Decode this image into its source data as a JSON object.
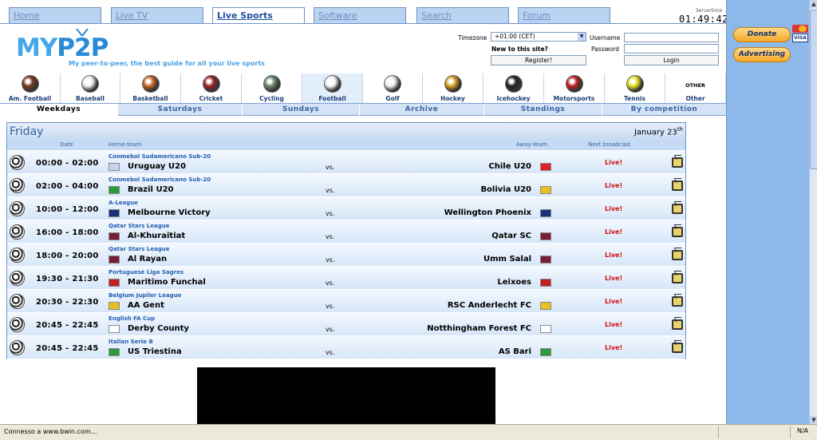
{
  "top_tabs": [
    {
      "label": "Home"
    },
    {
      "label": "Live TV"
    },
    {
      "label": "Live Sports"
    },
    {
      "label": "Software"
    },
    {
      "label": "Search"
    },
    {
      "label": "Forum"
    }
  ],
  "servertime": {
    "label": "Servertime",
    "value": "01:49:42"
  },
  "logo": {
    "text_a": "MY",
    "text_b": "P2P",
    "tagline": "My peer-to-peer, the best guide for all your live sports"
  },
  "login": {
    "timezone_label": "Timezone",
    "timezone_value": "+01:00 (CET)",
    "new_label": "New to this site?",
    "register_label": "Register!",
    "username_label": "Username",
    "password_label": "Password",
    "login_label": "Login"
  },
  "sidebar": {
    "donate_label": "Donate",
    "advertising_label": "Advertising",
    "visa_label": "VISA"
  },
  "sports": [
    {
      "label": "Am. Football",
      "icon": "american-football-icon",
      "color": "#7a3a1a"
    },
    {
      "label": "Baseball",
      "icon": "baseball-icon",
      "color": "#f0f0f0"
    },
    {
      "label": "Basketball",
      "icon": "basketball-icon",
      "color": "#c8652a"
    },
    {
      "label": "Cricket",
      "icon": "cricket-ball-icon",
      "color": "#9a2222"
    },
    {
      "label": "Cycling",
      "icon": "cycling-icon",
      "color": "#6a8a6a"
    },
    {
      "label": "Football",
      "icon": "football-icon",
      "color": "#f5f5f5"
    },
    {
      "label": "Golf",
      "icon": "golf-ball-icon",
      "color": "#eeeeee"
    },
    {
      "label": "Hockey",
      "icon": "hockey-icon",
      "color": "#d8a020"
    },
    {
      "label": "Icehockey",
      "icon": "puck-icon",
      "color": "#222222"
    },
    {
      "label": "Motorsports",
      "icon": "race-car-icon",
      "color": "#c02020"
    },
    {
      "label": "Tennis",
      "icon": "tennis-ball-icon",
      "color": "#e8e020"
    },
    {
      "label": "Other",
      "icon": "other-icon",
      "color": "#ffffff",
      "badge": "OTHER"
    }
  ],
  "day_tabs": [
    {
      "label": "Weekdays"
    },
    {
      "label": "Saturdays"
    },
    {
      "label": "Sundays"
    },
    {
      "label": "Archive"
    },
    {
      "label": "Standings"
    },
    {
      "label": "By competition"
    }
  ],
  "panel": {
    "day": "Friday",
    "date": "January 23",
    "date_suffix": "th",
    "col_date": "Date",
    "col_home": "Home-team",
    "col_away": "Away-team",
    "col_next": "Next broadcast"
  },
  "matches": [
    {
      "time": "00:00 - 02:00",
      "league": "Conmebol Sudamericano Sub-20",
      "home": "Uruguay U20",
      "away": "Chile U20",
      "vs": "vs.",
      "live": "Live!"
    },
    {
      "time": "02:00 - 04:00",
      "league": "Conmebol Sudamericano Sub-20",
      "home": "Brazil U20",
      "away": "Bolivia U20",
      "vs": "vs.",
      "live": "Live!"
    },
    {
      "time": "10:00 - 12:00",
      "league": "A-League",
      "home": "Melbourne Victory",
      "away": "Wellington Phoenix",
      "vs": "vs.",
      "live": "Live!"
    },
    {
      "time": "16:00 - 18:00",
      "league": "Qatar Stars League",
      "home": "Al-Khuraitiat",
      "away": "Qatar SC",
      "vs": "vs.",
      "live": "Live!"
    },
    {
      "time": "18:00 - 20:00",
      "league": "Qatar Stars League",
      "home": "Al Rayan",
      "away": "Umm Salal",
      "vs": "vs.",
      "live": "Live!"
    },
    {
      "time": "19:30 - 21:30",
      "league": "Portuguese Liga Sagres",
      "home": "Maritimo Funchal",
      "away": "Leixoes",
      "vs": "vs.",
      "live": "Live!"
    },
    {
      "time": "20:30 - 22:30",
      "league": "Belgium Jupiler League",
      "home": "AA Gent",
      "away": "RSC Anderlecht FC",
      "vs": "vs.",
      "live": "Live!"
    },
    {
      "time": "20:45 - 22:45",
      "league": "English FA Cup",
      "home": "Derby County",
      "away": "Notthingham Forest FC",
      "vs": "vs.",
      "live": "Live!"
    },
    {
      "time": "20:45 - 22:45",
      "league": "Italian Serie B",
      "home": "US Triestina",
      "away": "AS Bari",
      "vs": "vs.",
      "live": "Live!"
    }
  ],
  "flags": {
    "uruguay": "#c8d4ee",
    "chile": "#d22",
    "brazil": "#2a9a3a",
    "bolivia": "#e8c020",
    "australia": "#1c2f7a",
    "newzealand": "#1c2f7a",
    "qatar": "#7a1d3a",
    "portugal": "#c02020",
    "belgium": "#e8c020",
    "england": "#ffffff",
    "italy": "#2a9a3a"
  },
  "status": {
    "text": "Connesso a www.bwin.com...",
    "zone": "N/A"
  }
}
